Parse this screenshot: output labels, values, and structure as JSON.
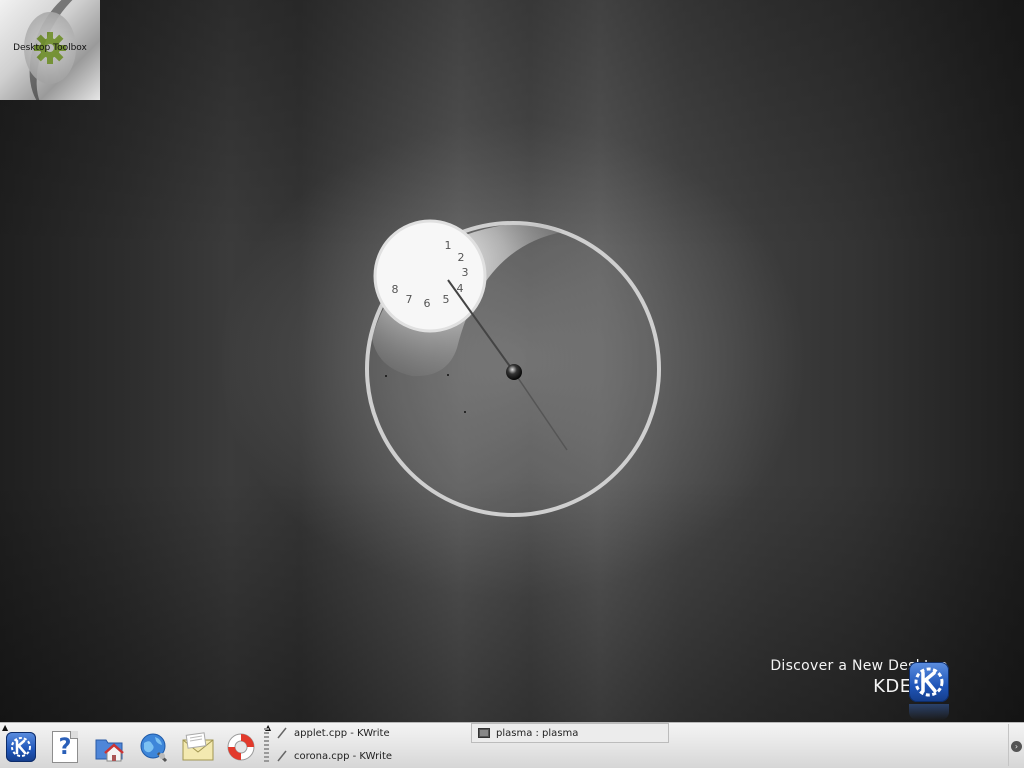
{
  "desktop": {
    "toolbox_label": "Desktop Toolbox",
    "branding": {
      "tagline": "Discover a New Desktop",
      "version": "KDE 4.0",
      "logo_icon": "kde-logo-icon"
    },
    "clock": {
      "numerals": [
        "1",
        "2",
        "3",
        "4",
        "5",
        "6",
        "7",
        "8"
      ]
    }
  },
  "panel": {
    "launchers": [
      {
        "name": "kde-menu",
        "icon": "kde-menu-icon"
      },
      {
        "name": "help",
        "icon": "help-icon",
        "glyph": "?"
      },
      {
        "name": "home-folder",
        "icon": "home-folder-icon"
      },
      {
        "name": "web-browser",
        "icon": "globe-icon"
      },
      {
        "name": "mail",
        "icon": "mail-envelope-icon"
      },
      {
        "name": "help-center",
        "icon": "lifebuoy-icon"
      }
    ],
    "tasks": [
      {
        "label": "applet.cpp - KWrite",
        "icon": "kwrite-icon"
      },
      {
        "label": "corona.cpp - KWrite",
        "icon": "kwrite-icon"
      },
      {
        "label": "plasma : plasma",
        "icon": "terminal-icon"
      }
    ],
    "systray_toggle_icon": "chevron-right-icon"
  },
  "colors": {
    "panel_bg": "#e6e6e6",
    "kde_blue": "#1f55b8"
  }
}
